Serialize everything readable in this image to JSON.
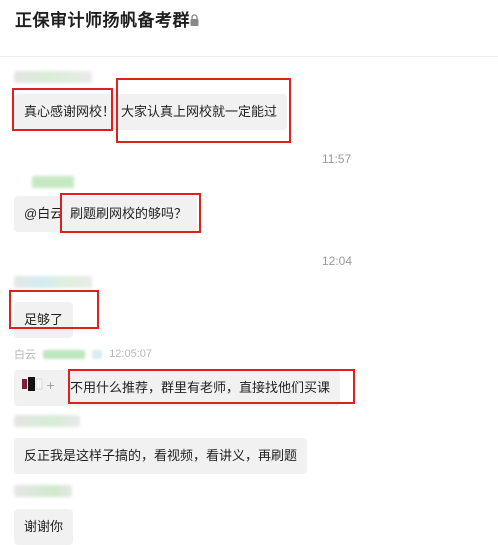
{
  "header": {
    "title": "正保审计师扬帆备考群",
    "lock_icon": "lock-icon"
  },
  "messages": [
    {
      "text": "真心感谢网校！"
    },
    {
      "text": "大家认真上网校就一定能过"
    },
    {
      "text": "@白云"
    },
    {
      "text": "刷题刷网校的够吗？"
    },
    {
      "text": "足够了"
    },
    {
      "text": "不用什么推荐，群里有老师，直接找他们买课"
    },
    {
      "text": "反正我是这样子搞的，看视频，看讲义，再刷题"
    },
    {
      "text": "谢谢你"
    }
  ],
  "timestamps": {
    "t1": "11:57",
    "t2": "12:04",
    "t3": "12:05:07"
  },
  "meta": {
    "partial_sender": "白云",
    "partial_tag": "学生"
  },
  "colors": {
    "highlight": "#e0201c",
    "bubble": "#f1f1f1",
    "timestamp": "#9a9a9a"
  }
}
